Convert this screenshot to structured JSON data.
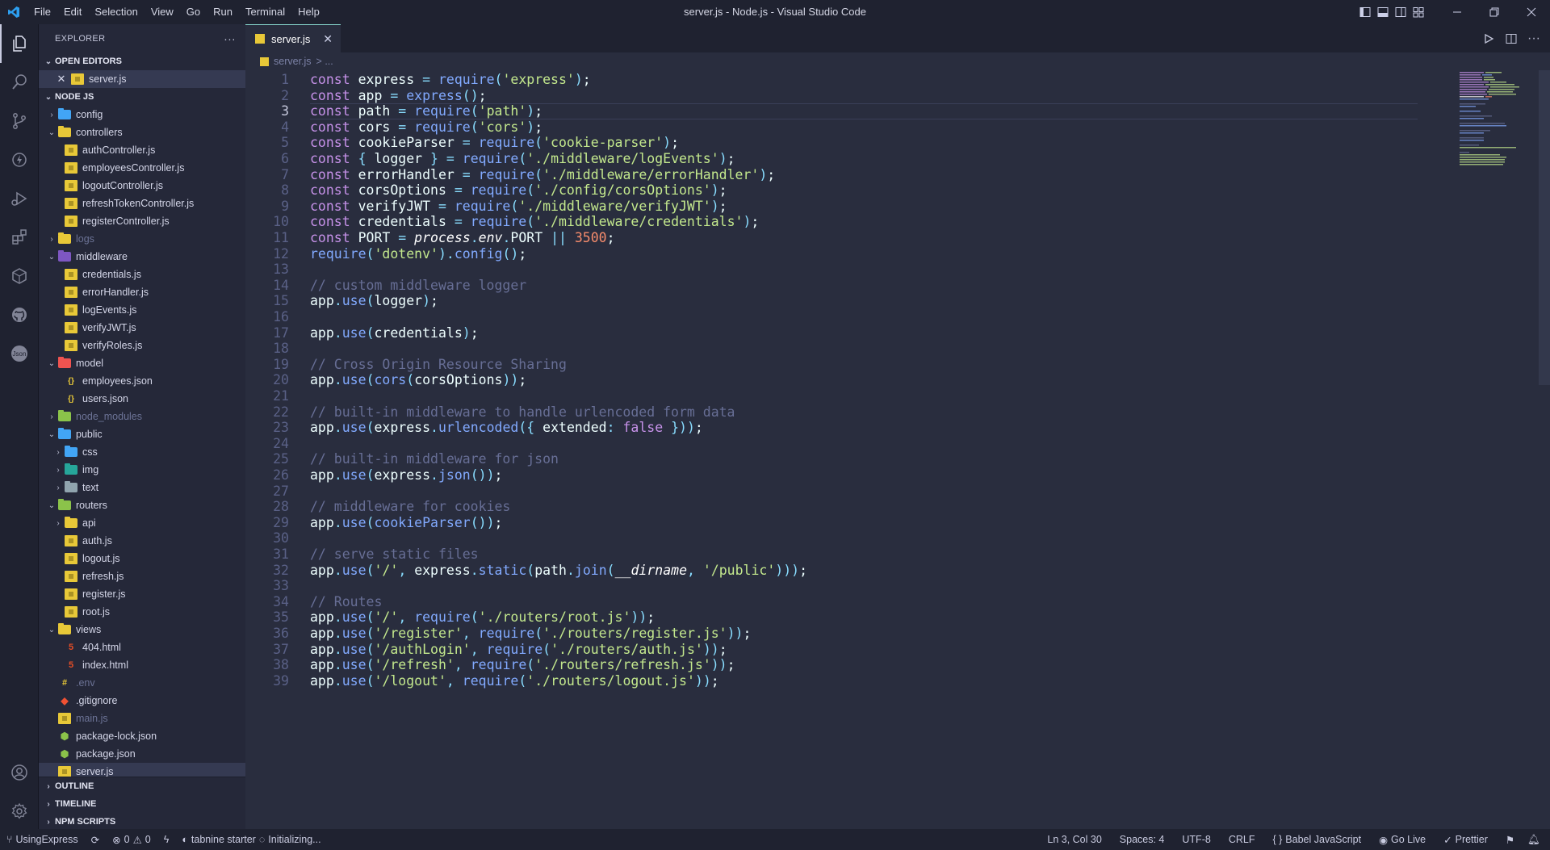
{
  "window": {
    "title": "server.js - Node.js - Visual Studio Code",
    "menu": [
      "File",
      "Edit",
      "Selection",
      "View",
      "Go",
      "Run",
      "Terminal",
      "Help"
    ]
  },
  "sidebar": {
    "header": "EXPLORER",
    "open_editors_label": "OPEN EDITORS",
    "open_editors": [
      {
        "label": "server.js",
        "icon": "js-file-icon"
      }
    ],
    "workspace_label": "NODE JS",
    "tree": [
      {
        "label": "config",
        "type": "folder",
        "depth": 0,
        "expanded": false,
        "color": "#42a5f5"
      },
      {
        "label": "controllers",
        "type": "folder",
        "depth": 0,
        "expanded": true,
        "color": "#e8c838"
      },
      {
        "label": "authController.js",
        "type": "js",
        "depth": 1
      },
      {
        "label": "employeesController.js",
        "type": "js",
        "depth": 1
      },
      {
        "label": "logoutController.js",
        "type": "js",
        "depth": 1
      },
      {
        "label": "refreshTokenController.js",
        "type": "js",
        "depth": 1
      },
      {
        "label": "registerController.js",
        "type": "js",
        "depth": 1
      },
      {
        "label": "logs",
        "type": "folder",
        "depth": 0,
        "expanded": false,
        "dim": true,
        "color": "#e8c838"
      },
      {
        "label": "middleware",
        "type": "folder",
        "depth": 0,
        "expanded": true,
        "color": "#7e57c2"
      },
      {
        "label": "credentials.js",
        "type": "js",
        "depth": 1
      },
      {
        "label": "errorHandler.js",
        "type": "js",
        "depth": 1
      },
      {
        "label": "logEvents.js",
        "type": "js",
        "depth": 1
      },
      {
        "label": "verifyJWT.js",
        "type": "js",
        "depth": 1
      },
      {
        "label": "verifyRoles.js",
        "type": "js",
        "depth": 1
      },
      {
        "label": "model",
        "type": "folder",
        "depth": 0,
        "expanded": true,
        "color": "#ef5350"
      },
      {
        "label": "employees.json",
        "type": "json",
        "depth": 1
      },
      {
        "label": "users.json",
        "type": "json",
        "depth": 1
      },
      {
        "label": "node_modules",
        "type": "folder",
        "depth": 0,
        "expanded": false,
        "dim": true,
        "color": "#8bc34a"
      },
      {
        "label": "public",
        "type": "folder",
        "depth": 0,
        "expanded": true,
        "color": "#42a5f5"
      },
      {
        "label": "css",
        "type": "folder",
        "depth": 1,
        "expanded": false,
        "color": "#42a5f5"
      },
      {
        "label": "img",
        "type": "folder",
        "depth": 1,
        "expanded": false,
        "color": "#26a69a"
      },
      {
        "label": "text",
        "type": "folder",
        "depth": 1,
        "expanded": false,
        "color": "#90a4ae"
      },
      {
        "label": "routers",
        "type": "folder",
        "depth": 0,
        "expanded": true,
        "color": "#8bc34a"
      },
      {
        "label": "api",
        "type": "folder",
        "depth": 1,
        "expanded": false,
        "color": "#e8c838"
      },
      {
        "label": "auth.js",
        "type": "js",
        "depth": 1
      },
      {
        "label": "logout.js",
        "type": "js",
        "depth": 1
      },
      {
        "label": "refresh.js",
        "type": "js",
        "depth": 1
      },
      {
        "label": "register.js",
        "type": "js",
        "depth": 1
      },
      {
        "label": "root.js",
        "type": "js",
        "depth": 1
      },
      {
        "label": "views",
        "type": "folder",
        "depth": 0,
        "expanded": true,
        "color": "#e8c838"
      },
      {
        "label": "404.html",
        "type": "html",
        "depth": 1
      },
      {
        "label": "index.html",
        "type": "html",
        "depth": 1
      },
      {
        "label": ".env",
        "type": "env",
        "depth": 0,
        "dim": true
      },
      {
        "label": ".gitignore",
        "type": "git",
        "depth": 0
      },
      {
        "label": "main.js",
        "type": "js",
        "depth": 0,
        "dim": true
      },
      {
        "label": "package-lock.json",
        "type": "pkg",
        "depth": 0
      },
      {
        "label": "package.json",
        "type": "pkg",
        "depth": 0
      },
      {
        "label": "server.js",
        "type": "js",
        "depth": 0,
        "selected": true
      }
    ],
    "outline_label": "OUTLINE",
    "timeline_label": "TIMELINE",
    "npm_label": "NPM SCRIPTS"
  },
  "tab": {
    "label": "server.js"
  },
  "breadcrumb": {
    "file": "server.js",
    "rest": "> ..."
  },
  "editor": {
    "current_line": 3,
    "lines": [
      [
        [
          "kw",
          "const "
        ],
        [
          "var",
          "express "
        ],
        [
          "op",
          "= "
        ],
        [
          "fn",
          "require"
        ],
        [
          "pu",
          "("
        ],
        [
          "str",
          "'express'"
        ],
        [
          "pu",
          ")"
        ],
        [
          "var",
          ";"
        ]
      ],
      [
        [
          "kw",
          "const "
        ],
        [
          "var",
          "app "
        ],
        [
          "op",
          "= "
        ],
        [
          "fn",
          "express"
        ],
        [
          "pu",
          "()"
        ],
        [
          "var",
          ";"
        ]
      ],
      [
        [
          "kw",
          "const "
        ],
        [
          "var",
          "path "
        ],
        [
          "op",
          "= "
        ],
        [
          "fn",
          "require"
        ],
        [
          "pu",
          "("
        ],
        [
          "str",
          "'path'"
        ],
        [
          "pu",
          ")"
        ],
        [
          "var",
          ";"
        ]
      ],
      [
        [
          "kw",
          "const "
        ],
        [
          "var",
          "cors "
        ],
        [
          "op",
          "= "
        ],
        [
          "fn",
          "require"
        ],
        [
          "pu",
          "("
        ],
        [
          "str",
          "'cors'"
        ],
        [
          "pu",
          ")"
        ],
        [
          "var",
          ";"
        ]
      ],
      [
        [
          "kw",
          "const "
        ],
        [
          "var",
          "cookieParser "
        ],
        [
          "op",
          "= "
        ],
        [
          "fn",
          "require"
        ],
        [
          "pu",
          "("
        ],
        [
          "str",
          "'cookie-parser'"
        ],
        [
          "pu",
          ")"
        ],
        [
          "var",
          ";"
        ]
      ],
      [
        [
          "kw",
          "const "
        ],
        [
          "pu",
          "{ "
        ],
        [
          "var",
          "logger "
        ],
        [
          "pu",
          "} "
        ],
        [
          "op",
          "= "
        ],
        [
          "fn",
          "require"
        ],
        [
          "pu",
          "("
        ],
        [
          "str",
          "'./middleware/logEvents'"
        ],
        [
          "pu",
          ")"
        ],
        [
          "var",
          ";"
        ]
      ],
      [
        [
          "kw",
          "const "
        ],
        [
          "var",
          "errorHandler "
        ],
        [
          "op",
          "= "
        ],
        [
          "fn",
          "require"
        ],
        [
          "pu",
          "("
        ],
        [
          "str",
          "'./middleware/errorHandler'"
        ],
        [
          "pu",
          ")"
        ],
        [
          "var",
          ";"
        ]
      ],
      [
        [
          "kw",
          "const "
        ],
        [
          "var",
          "corsOptions "
        ],
        [
          "op",
          "= "
        ],
        [
          "fn",
          "require"
        ],
        [
          "pu",
          "("
        ],
        [
          "str",
          "'./config/corsOptions'"
        ],
        [
          "pu",
          ")"
        ],
        [
          "var",
          ";"
        ]
      ],
      [
        [
          "kw",
          "const "
        ],
        [
          "var",
          "verifyJWT "
        ],
        [
          "op",
          "= "
        ],
        [
          "fn",
          "require"
        ],
        [
          "pu",
          "("
        ],
        [
          "str",
          "'./middleware/verifyJWT'"
        ],
        [
          "pu",
          ")"
        ],
        [
          "var",
          ";"
        ]
      ],
      [
        [
          "kw",
          "const "
        ],
        [
          "var",
          "credentials "
        ],
        [
          "op",
          "= "
        ],
        [
          "fn",
          "require"
        ],
        [
          "pu",
          "("
        ],
        [
          "str",
          "'./middleware/credentials'"
        ],
        [
          "pu",
          ")"
        ],
        [
          "var",
          ";"
        ]
      ],
      [
        [
          "kw",
          "const "
        ],
        [
          "var",
          "PORT "
        ],
        [
          "op",
          "= "
        ],
        [
          "it",
          "process"
        ],
        [
          "pu",
          "."
        ],
        [
          "it",
          "env"
        ],
        [
          "pu",
          "."
        ],
        [
          "var",
          "PORT "
        ],
        [
          "op",
          "|| "
        ],
        [
          "nm2",
          "3500"
        ],
        [
          "var",
          ";"
        ]
      ],
      [
        [
          "fn",
          "require"
        ],
        [
          "pu",
          "("
        ],
        [
          "str",
          "'dotenv'"
        ],
        [
          "pu",
          ")."
        ],
        [
          "fn",
          "config"
        ],
        [
          "pu",
          "()"
        ],
        [
          "var",
          ";"
        ]
      ],
      [],
      [
        [
          "cm",
          "// custom middleware logger"
        ]
      ],
      [
        [
          "var",
          "app"
        ],
        [
          "pu",
          "."
        ],
        [
          "fn",
          "use"
        ],
        [
          "pu",
          "("
        ],
        [
          "var",
          "logger"
        ],
        [
          "pu",
          ")"
        ],
        [
          "var",
          ";"
        ]
      ],
      [],
      [
        [
          "var",
          "app"
        ],
        [
          "pu",
          "."
        ],
        [
          "fn",
          "use"
        ],
        [
          "pu",
          "("
        ],
        [
          "var",
          "credentials"
        ],
        [
          "pu",
          ")"
        ],
        [
          "var",
          ";"
        ]
      ],
      [],
      [
        [
          "cm",
          "// Cross Origin Resource Sharing"
        ]
      ],
      [
        [
          "var",
          "app"
        ],
        [
          "pu",
          "."
        ],
        [
          "fn",
          "use"
        ],
        [
          "pu",
          "("
        ],
        [
          "fn",
          "cors"
        ],
        [
          "pu",
          "("
        ],
        [
          "var",
          "corsOptions"
        ],
        [
          "pu",
          "))"
        ],
        [
          "var",
          ";"
        ]
      ],
      [],
      [
        [
          "cm",
          "// built-in middleware to handle urlencoded form data"
        ]
      ],
      [
        [
          "var",
          "app"
        ],
        [
          "pu",
          "."
        ],
        [
          "fn",
          "use"
        ],
        [
          "pu",
          "("
        ],
        [
          "var",
          "express"
        ],
        [
          "pu",
          "."
        ],
        [
          "fn",
          "urlencoded"
        ],
        [
          "pu",
          "({ "
        ],
        [
          "var",
          "extended"
        ],
        [
          "pu",
          ": "
        ],
        [
          "kw",
          "false "
        ],
        [
          "pu",
          "}))"
        ],
        [
          "var",
          ";"
        ]
      ],
      [],
      [
        [
          "cm",
          "// built-in middleware for json"
        ]
      ],
      [
        [
          "var",
          "app"
        ],
        [
          "pu",
          "."
        ],
        [
          "fn",
          "use"
        ],
        [
          "pu",
          "("
        ],
        [
          "var",
          "express"
        ],
        [
          "pu",
          "."
        ],
        [
          "fn",
          "json"
        ],
        [
          "pu",
          "())"
        ],
        [
          "var",
          ";"
        ]
      ],
      [],
      [
        [
          "cm",
          "// middleware for cookies"
        ]
      ],
      [
        [
          "var",
          "app"
        ],
        [
          "pu",
          "."
        ],
        [
          "fn",
          "use"
        ],
        [
          "pu",
          "("
        ],
        [
          "fn",
          "cookieParser"
        ],
        [
          "pu",
          "())"
        ],
        [
          "var",
          ";"
        ]
      ],
      [],
      [
        [
          "cm",
          "// serve static files"
        ]
      ],
      [
        [
          "var",
          "app"
        ],
        [
          "pu",
          "."
        ],
        [
          "fn",
          "use"
        ],
        [
          "pu",
          "("
        ],
        [
          "str",
          "'/'"
        ],
        [
          "pu",
          ", "
        ],
        [
          "var",
          "express"
        ],
        [
          "pu",
          "."
        ],
        [
          "fn",
          "static"
        ],
        [
          "pu",
          "("
        ],
        [
          "var",
          "path"
        ],
        [
          "pu",
          "."
        ],
        [
          "fn",
          "join"
        ],
        [
          "pu",
          "("
        ],
        [
          "it",
          "__dirname"
        ],
        [
          "pu",
          ", "
        ],
        [
          "str",
          "'/public'"
        ],
        [
          "pu",
          ")))"
        ],
        [
          "var",
          ";"
        ]
      ],
      [],
      [
        [
          "cm",
          "// Routes"
        ]
      ],
      [
        [
          "var",
          "app"
        ],
        [
          "pu",
          "."
        ],
        [
          "fn",
          "use"
        ],
        [
          "pu",
          "("
        ],
        [
          "str",
          "'/'"
        ],
        [
          "pu",
          ", "
        ],
        [
          "fn",
          "require"
        ],
        [
          "pu",
          "("
        ],
        [
          "str",
          "'./routers/root.js'"
        ],
        [
          "pu",
          "))"
        ],
        [
          "var",
          ";"
        ]
      ],
      [
        [
          "var",
          "app"
        ],
        [
          "pu",
          "."
        ],
        [
          "fn",
          "use"
        ],
        [
          "pu",
          "("
        ],
        [
          "str",
          "'/register'"
        ],
        [
          "pu",
          ", "
        ],
        [
          "fn",
          "require"
        ],
        [
          "pu",
          "("
        ],
        [
          "str",
          "'./routers/register.js'"
        ],
        [
          "pu",
          "))"
        ],
        [
          "var",
          ";"
        ]
      ],
      [
        [
          "var",
          "app"
        ],
        [
          "pu",
          "."
        ],
        [
          "fn",
          "use"
        ],
        [
          "pu",
          "("
        ],
        [
          "str",
          "'/authLogin'"
        ],
        [
          "pu",
          ", "
        ],
        [
          "fn",
          "require"
        ],
        [
          "pu",
          "("
        ],
        [
          "str",
          "'./routers/auth.js'"
        ],
        [
          "pu",
          "))"
        ],
        [
          "var",
          ";"
        ]
      ],
      [
        [
          "var",
          "app"
        ],
        [
          "pu",
          "."
        ],
        [
          "fn",
          "use"
        ],
        [
          "pu",
          "("
        ],
        [
          "str",
          "'/refresh'"
        ],
        [
          "pu",
          ", "
        ],
        [
          "fn",
          "require"
        ],
        [
          "pu",
          "("
        ],
        [
          "str",
          "'./routers/refresh.js'"
        ],
        [
          "pu",
          "))"
        ],
        [
          "var",
          ";"
        ]
      ],
      [
        [
          "var",
          "app"
        ],
        [
          "pu",
          "."
        ],
        [
          "fn",
          "use"
        ],
        [
          "pu",
          "("
        ],
        [
          "str",
          "'/logout'"
        ],
        [
          "pu",
          ", "
        ],
        [
          "fn",
          "require"
        ],
        [
          "pu",
          "("
        ],
        [
          "str",
          "'./routers/logout.js'"
        ],
        [
          "pu",
          "))"
        ],
        [
          "var",
          ";"
        ]
      ]
    ]
  },
  "status": {
    "branch": "UsingExpress",
    "errors": "0",
    "warnings": "0",
    "tabnine": "tabnine starter",
    "initializing": "Initializing...",
    "position": "Ln 3, Col 30",
    "spaces": "Spaces: 4",
    "encoding": "UTF-8",
    "eol": "CRLF",
    "language": "Babel JavaScript",
    "golive": "Go Live",
    "prettier": "Prettier"
  }
}
